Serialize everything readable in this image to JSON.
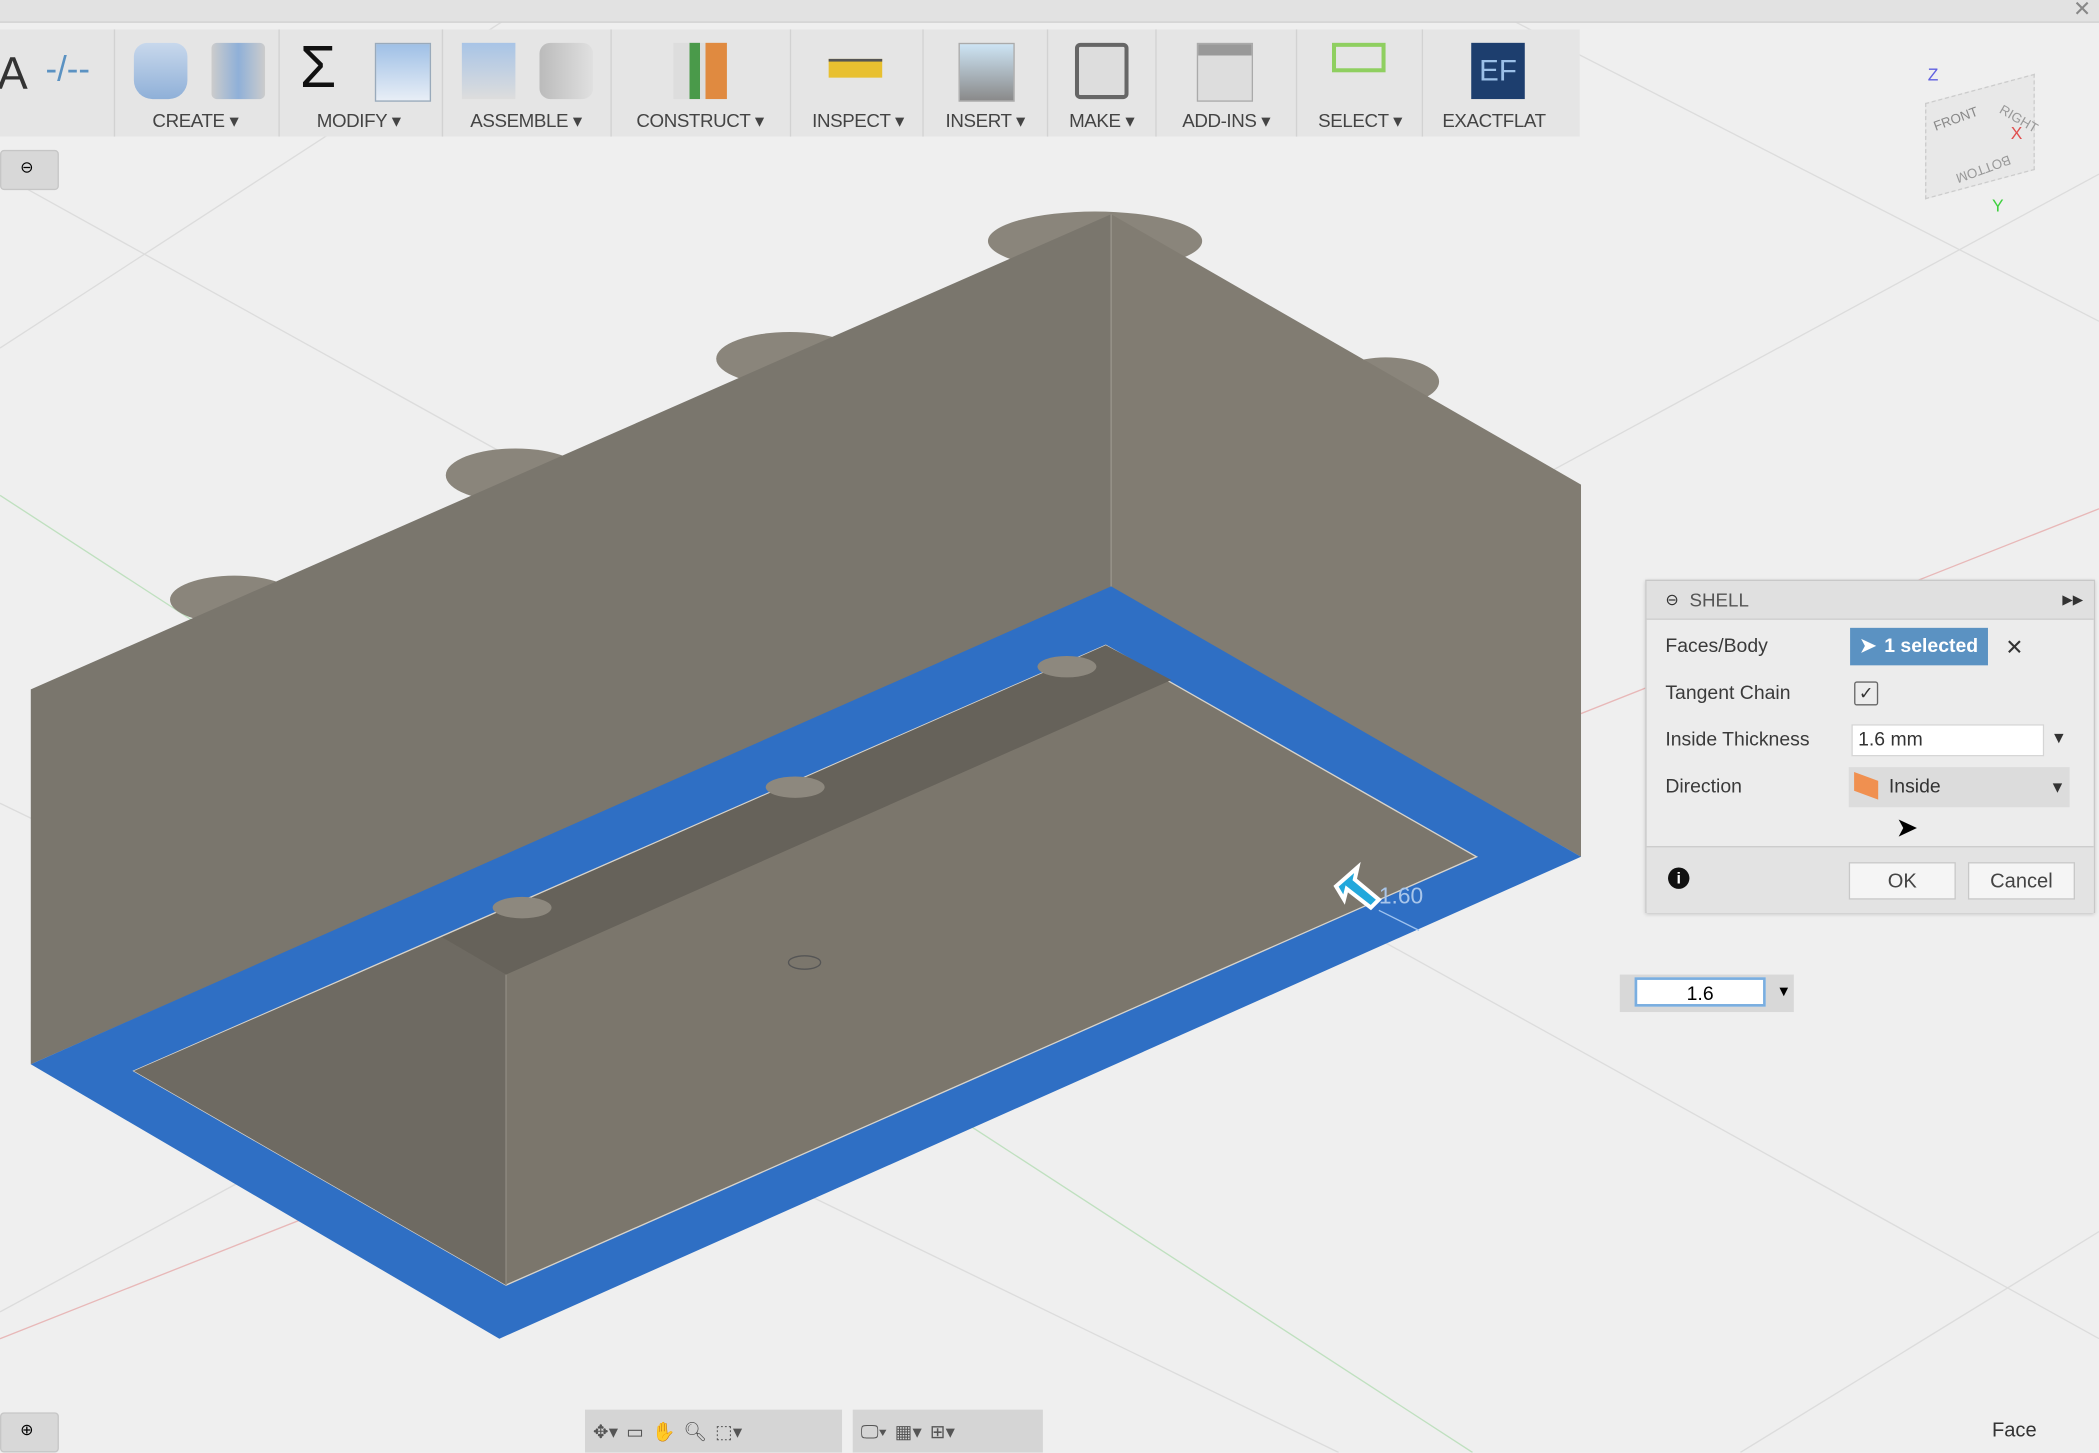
{
  "window": {
    "close_icon": "close-icon"
  },
  "toolbar": {
    "groups": [
      {
        "label": "CREATE ▾",
        "icons": [
          "extrude-icon",
          "revolve-icon"
        ]
      },
      {
        "label": "MODIFY ▾",
        "icons": [
          "sigma-icon",
          "press-pull-icon"
        ]
      },
      {
        "label": "ASSEMBLE ▾",
        "icons": [
          "new-component-icon",
          "joint-icon"
        ]
      },
      {
        "label": "CONSTRUCT ▾",
        "icons": [
          "offset-plane-icon"
        ]
      },
      {
        "label": "INSPECT ▾",
        "icons": [
          "measure-icon"
        ]
      },
      {
        "label": "INSERT ▾",
        "icons": [
          "insert-image-icon"
        ]
      },
      {
        "label": "MAKE ▾",
        "icons": [
          "3d-print-icon"
        ]
      },
      {
        "label": "ADD-INS ▾",
        "icons": [
          "scripts-icon"
        ]
      },
      {
        "label": "SELECT ▾",
        "icons": [
          "select-icon"
        ]
      },
      {
        "label": "EXACTFLAT",
        "icons": [
          "exactflat-icon"
        ]
      }
    ]
  },
  "viewcube": {
    "front": "FRONT",
    "right": "RIGHT",
    "bottom": "BOTTOM",
    "x": "X",
    "y": "Y",
    "z": "Z",
    "colors": {
      "x": "#e05050",
      "y": "#40d040",
      "z": "#6060e0"
    }
  },
  "shell_dialog": {
    "title": "SHELL",
    "faces_label": "Faces/Body",
    "faces_value": "1 selected",
    "tangent_label": "Tangent Chain",
    "tangent_checked": true,
    "thickness_label": "Inside Thickness",
    "thickness_value": "1.6 mm",
    "direction_label": "Direction",
    "direction_value": "Inside",
    "ok": "OK",
    "cancel": "Cancel"
  },
  "inline_input": {
    "value": "1.6"
  },
  "dimension_label": "1.60",
  "status": {
    "selection_type": "Face"
  },
  "colors": {
    "selected_face": "#2f6fc4",
    "body": "#7a766d",
    "accent": "#5b92c2"
  }
}
